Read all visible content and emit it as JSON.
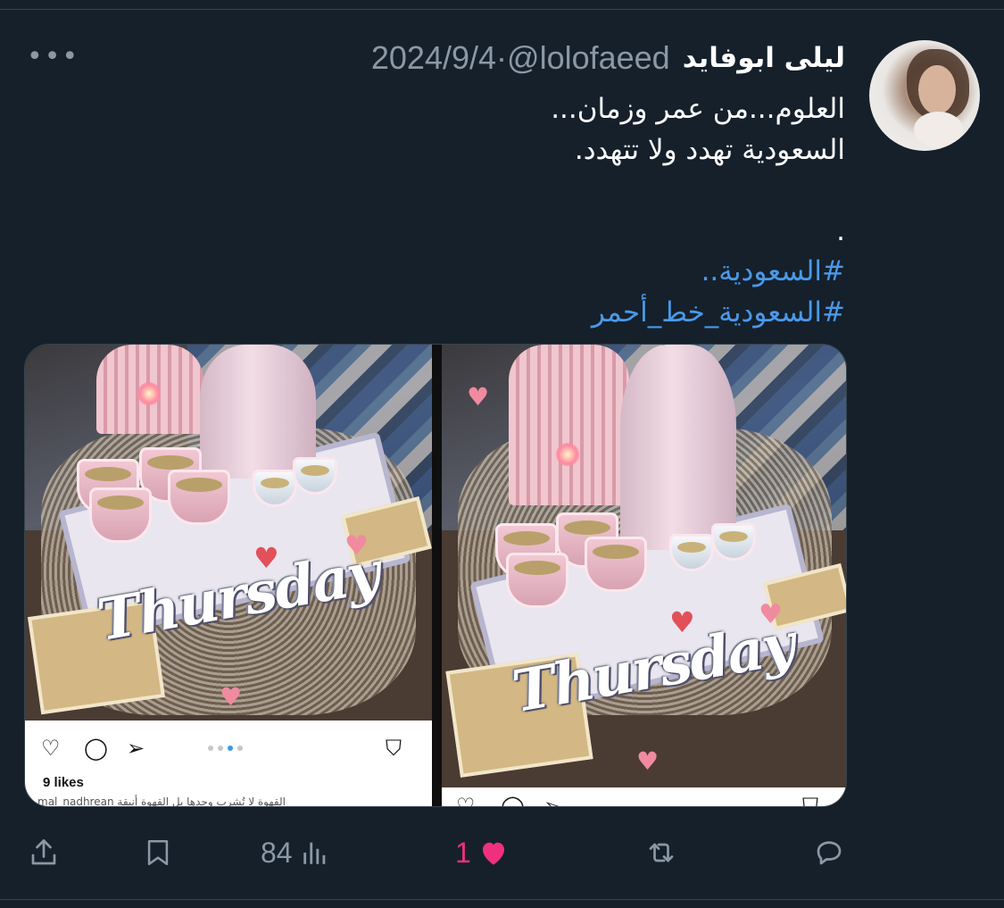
{
  "tweet": {
    "author_name": "ليلى ابوفايد",
    "handle": "@lolofaeed",
    "separator": "·",
    "date": "2024/9/4",
    "text_lines": [
      "العلوم...من عمر وزمان...",
      "السعودية تهدد ولا تتهدد.",
      "",
      "."
    ],
    "hashtags": [
      "#السعودية..",
      "#السعودية_خط_أحمر"
    ],
    "more_label": "•••"
  },
  "media": {
    "left_image": {
      "overlay_word": "Thursday",
      "likes": "9 likes",
      "caption": "mal_nadhrean القهوة لا تُشرب وحدها بل القهوة أنيقة"
    },
    "right_image": {
      "overlay_word": "Thursday"
    }
  },
  "actions": {
    "views_count": "84",
    "likes_count": "1",
    "liked": true,
    "colors": {
      "muted": "#8b98a5",
      "like": "#f0307f",
      "link": "#4a99e9",
      "background": "#15202b"
    }
  }
}
